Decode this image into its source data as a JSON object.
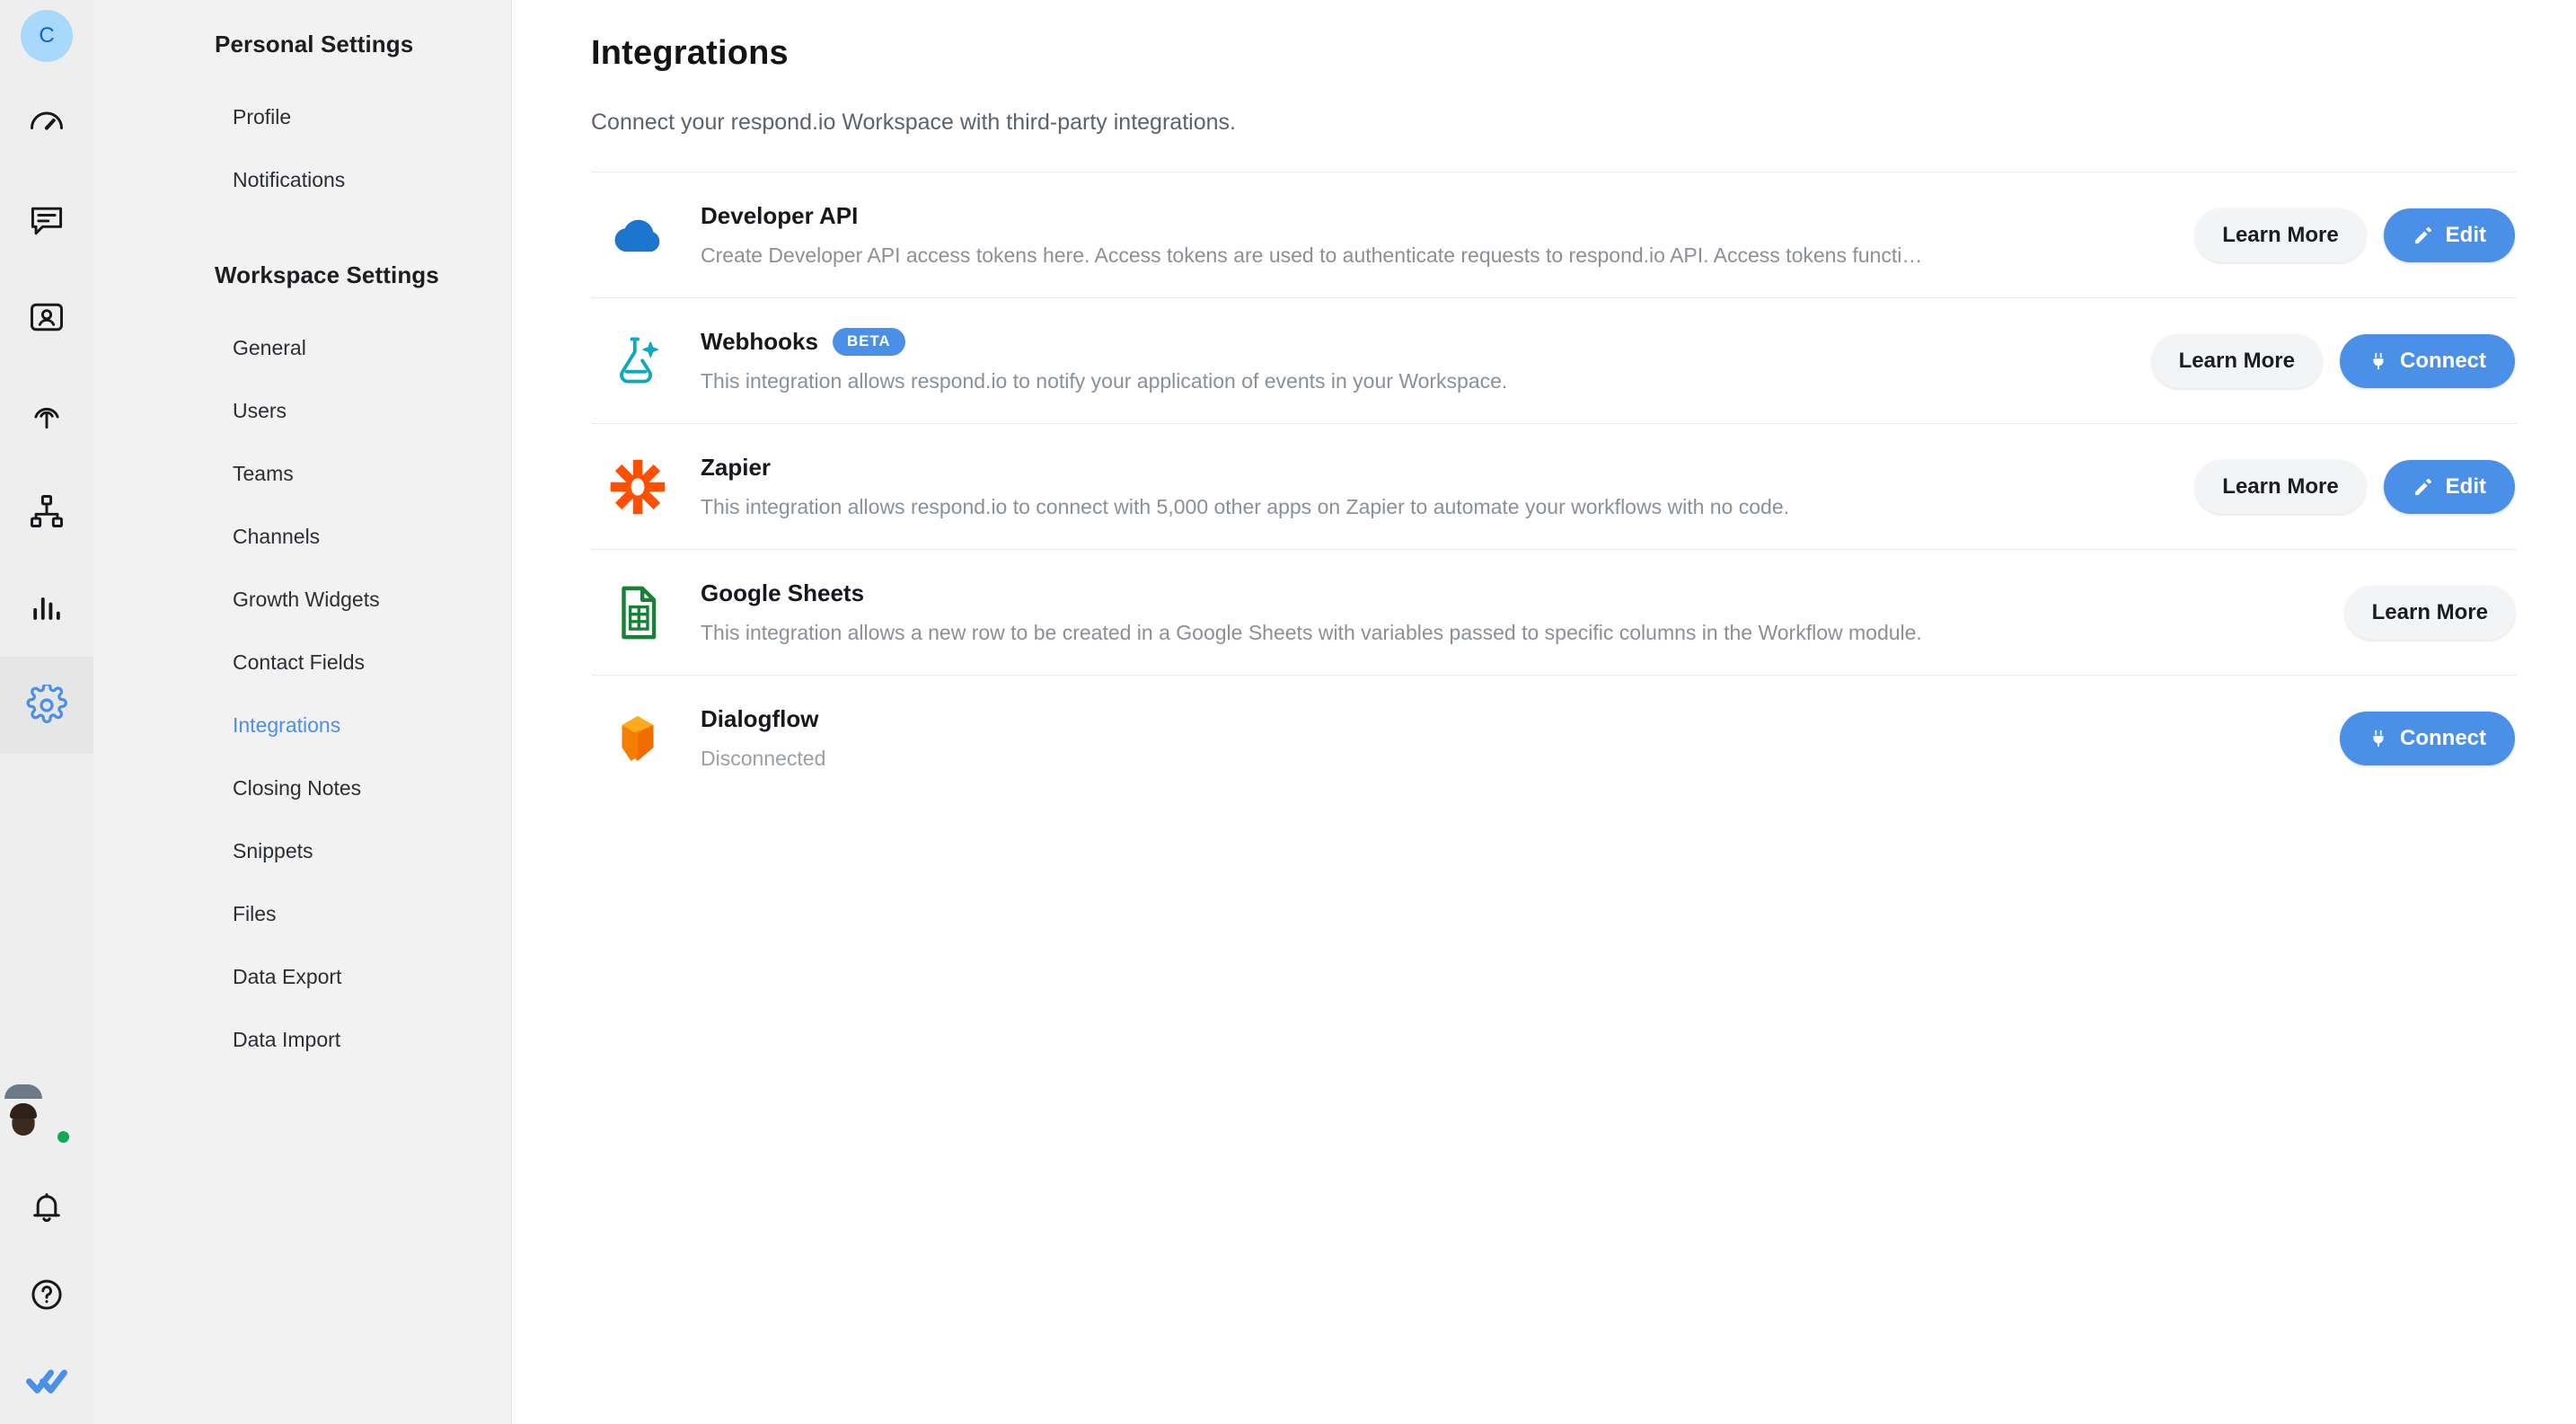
{
  "rail": {
    "workspace_initial": "C",
    "items": [
      {
        "name": "dashboard-icon",
        "label": "Dashboard",
        "active": false
      },
      {
        "name": "messages-icon",
        "label": "Messages",
        "active": false
      },
      {
        "name": "contacts-icon",
        "label": "Contacts",
        "active": false
      },
      {
        "name": "broadcasts-icon",
        "label": "Broadcasts",
        "active": false
      },
      {
        "name": "workflows-icon",
        "label": "Workflows",
        "active": false
      },
      {
        "name": "reports-icon",
        "label": "Reports",
        "active": false
      },
      {
        "name": "settings-gear-icon",
        "label": "Settings",
        "active": true
      }
    ],
    "bottom_items": [
      {
        "name": "user-avatar",
        "label": "Account"
      },
      {
        "name": "bell-icon",
        "label": "Notifications"
      },
      {
        "name": "help-question-icon",
        "label": "Help"
      },
      {
        "name": "respond-io-logo",
        "label": "respond.io"
      }
    ],
    "presence_color": "#0fa958",
    "avatar_bg": "#a8d8fb",
    "avatar_text_color": "#0b63ce",
    "active_color": "#4a90e8"
  },
  "sidebar": {
    "personal_heading": "Personal Settings",
    "personal_items": [
      {
        "label": "Profile",
        "active": false
      },
      {
        "label": "Notifications",
        "active": false
      }
    ],
    "workspace_heading": "Workspace Settings",
    "workspace_items": [
      {
        "label": "General",
        "active": false
      },
      {
        "label": "Users",
        "active": false
      },
      {
        "label": "Teams",
        "active": false
      },
      {
        "label": "Channels",
        "active": false
      },
      {
        "label": "Growth Widgets",
        "active": false
      },
      {
        "label": "Contact Fields",
        "active": false
      },
      {
        "label": "Integrations",
        "active": true
      },
      {
        "label": "Closing Notes",
        "active": false
      },
      {
        "label": "Snippets",
        "active": false
      },
      {
        "label": "Files",
        "active": false
      },
      {
        "label": "Data Export",
        "active": false
      },
      {
        "label": "Data Import",
        "active": false
      }
    ]
  },
  "main": {
    "title": "Integrations",
    "subtitle": "Connect your respond.io Workspace with third-party integrations.",
    "integrations": [
      {
        "icon": "cloud-icon",
        "icon_color": "#1d76cd",
        "title": "Developer API",
        "badge": null,
        "description": "Create Developer API access tokens here. Access tokens are used to authenticate requests to respond.io API. Access tokens functi…",
        "buttons": [
          {
            "label": "Learn More",
            "style": "secondary",
            "icon": null
          },
          {
            "label": "Edit",
            "style": "primary",
            "icon": "pencil-icon"
          }
        ]
      },
      {
        "icon": "webhooks-flask-icon",
        "icon_color": "#0fa8bf",
        "title": "Webhooks",
        "badge": "BETA",
        "description": "This integration allows respond.io to notify your application of events in your Workspace.",
        "buttons": [
          {
            "label": "Learn More",
            "style": "secondary",
            "icon": null
          },
          {
            "label": "Connect",
            "style": "primary",
            "icon": "plug-icon"
          }
        ]
      },
      {
        "icon": "zapier-icon",
        "icon_color": "#ff4f00",
        "title": "Zapier",
        "badge": null,
        "description": "This integration allows respond.io to connect with 5,000 other apps on Zapier to automate your workflows with no code.",
        "buttons": [
          {
            "label": "Learn More",
            "style": "secondary",
            "icon": null
          },
          {
            "label": "Edit",
            "style": "primary",
            "icon": "pencil-icon"
          }
        ]
      },
      {
        "icon": "google-sheets-icon",
        "icon_color": "#188038",
        "title": "Google Sheets",
        "badge": null,
        "description": "This integration allows a new row to be created in a Google Sheets with variables passed to specific columns in the Workflow module.",
        "buttons": [
          {
            "label": "Learn More",
            "style": "secondary",
            "icon": null
          }
        ]
      },
      {
        "icon": "dialogflow-icon",
        "icon_color": "#ef6c00",
        "title": "Dialogflow",
        "badge": null,
        "description": "Disconnected",
        "description_is_status": true,
        "buttons": [
          {
            "label": "Connect",
            "style": "primary",
            "icon": "plug-icon"
          }
        ]
      }
    ]
  }
}
